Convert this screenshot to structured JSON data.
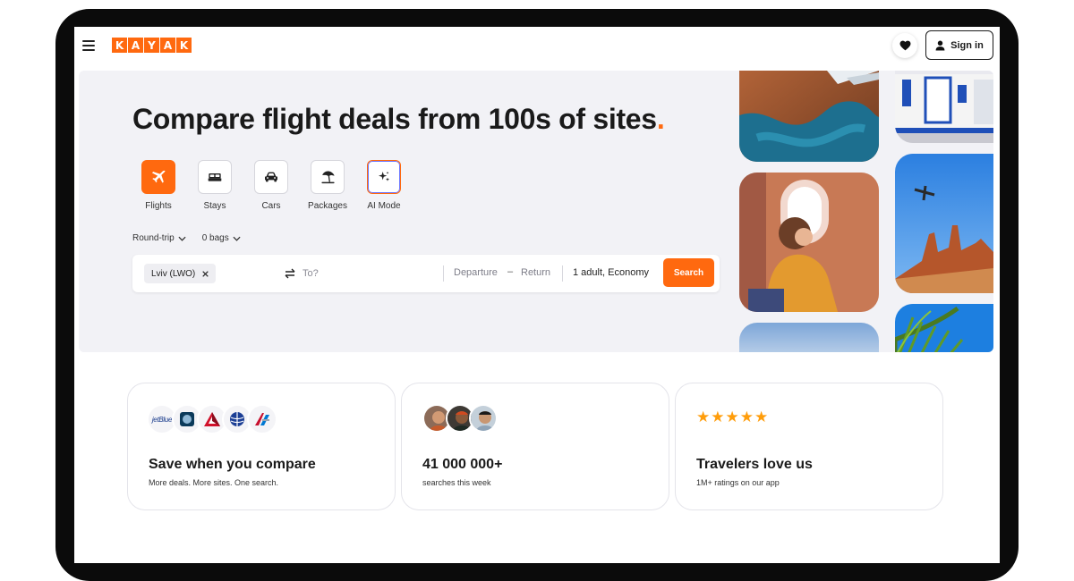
{
  "header": {
    "logo_letters": [
      "K",
      "A",
      "Y",
      "A",
      "K"
    ],
    "signin_label": "Sign in",
    "menu_icon": "hamburger-icon",
    "favorites_icon": "heart-icon",
    "account_icon": "person-icon"
  },
  "hero": {
    "headline": "Compare flight deals from 100s of sites",
    "headline_dot": ".",
    "verticals": [
      {
        "label": "Flights",
        "icon": "plane-icon",
        "active": true
      },
      {
        "label": "Stays",
        "icon": "bed-icon",
        "active": false
      },
      {
        "label": "Cars",
        "icon": "car-icon",
        "active": false
      },
      {
        "label": "Packages",
        "icon": "beach-umbrella-icon",
        "active": false
      },
      {
        "label": "AI Mode",
        "icon": "sparkle-icon",
        "active": false
      }
    ],
    "trip_type": "Round-trip",
    "bags": "0 bags"
  },
  "search": {
    "origin": "Lviv (LWO)",
    "destination_placeholder": "To?",
    "departure": "Departure",
    "date_separator": "–",
    "return": "Return",
    "passengers": "1 adult, Economy",
    "search_label": "Search"
  },
  "cards": [
    {
      "title": "Save when you compare",
      "subtitle": "More deals. More sites. One search.",
      "airline_logos": [
        "jetBlue",
        "Alaska",
        "Delta",
        "United",
        "American"
      ]
    },
    {
      "title": "41 000 000+",
      "subtitle": "searches this week"
    },
    {
      "title": "Travelers love us",
      "subtitle": "1M+ ratings on our app",
      "stars": "★★★★★",
      "rating": 5
    }
  ],
  "colors": {
    "brand": "#ff690f",
    "hero_bg": "#f2f2f6",
    "text": "#1a1a1a",
    "star": "#ff9d0b"
  }
}
